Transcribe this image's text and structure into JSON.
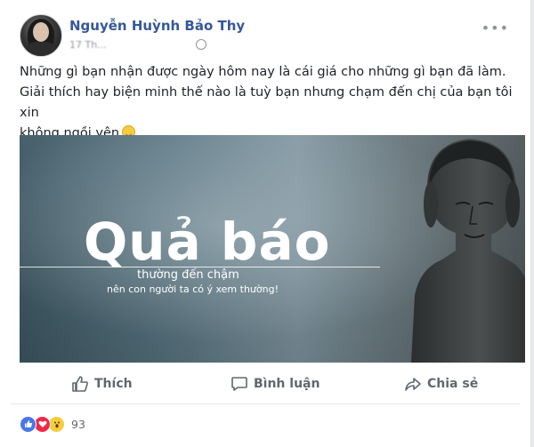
{
  "post": {
    "author": "Nguyễn Huỳnh Bảo Thy",
    "meta": "17 Th...",
    "text_lines": [
      "Những gì bạn nhận được ngày hôm nay là cái giá cho những gì bạn đã làm.",
      "Giải thích hay biện minh thế nào là tuỳ bạn nhưng chạm đến chị của bạn tôi xin",
      "không ngồi yên"
    ]
  },
  "image": {
    "title": "Quả báo",
    "subtitle": "thường đến chậm",
    "caption": "nên con người ta có ý xem thường!"
  },
  "actions": {
    "like_label": "Thích",
    "comment_label": "Bình luận",
    "share_label": "Chia sẻ"
  },
  "reactions": {
    "count": "93",
    "types": [
      "like-icon",
      "love-icon",
      "wow-icon"
    ]
  },
  "colors": {
    "author_blue": "#365899",
    "action_gray": "#606770",
    "like_blue": "#4a76e8",
    "love_red": "#f0284a",
    "wow_yellow": "#f7cd3e"
  }
}
